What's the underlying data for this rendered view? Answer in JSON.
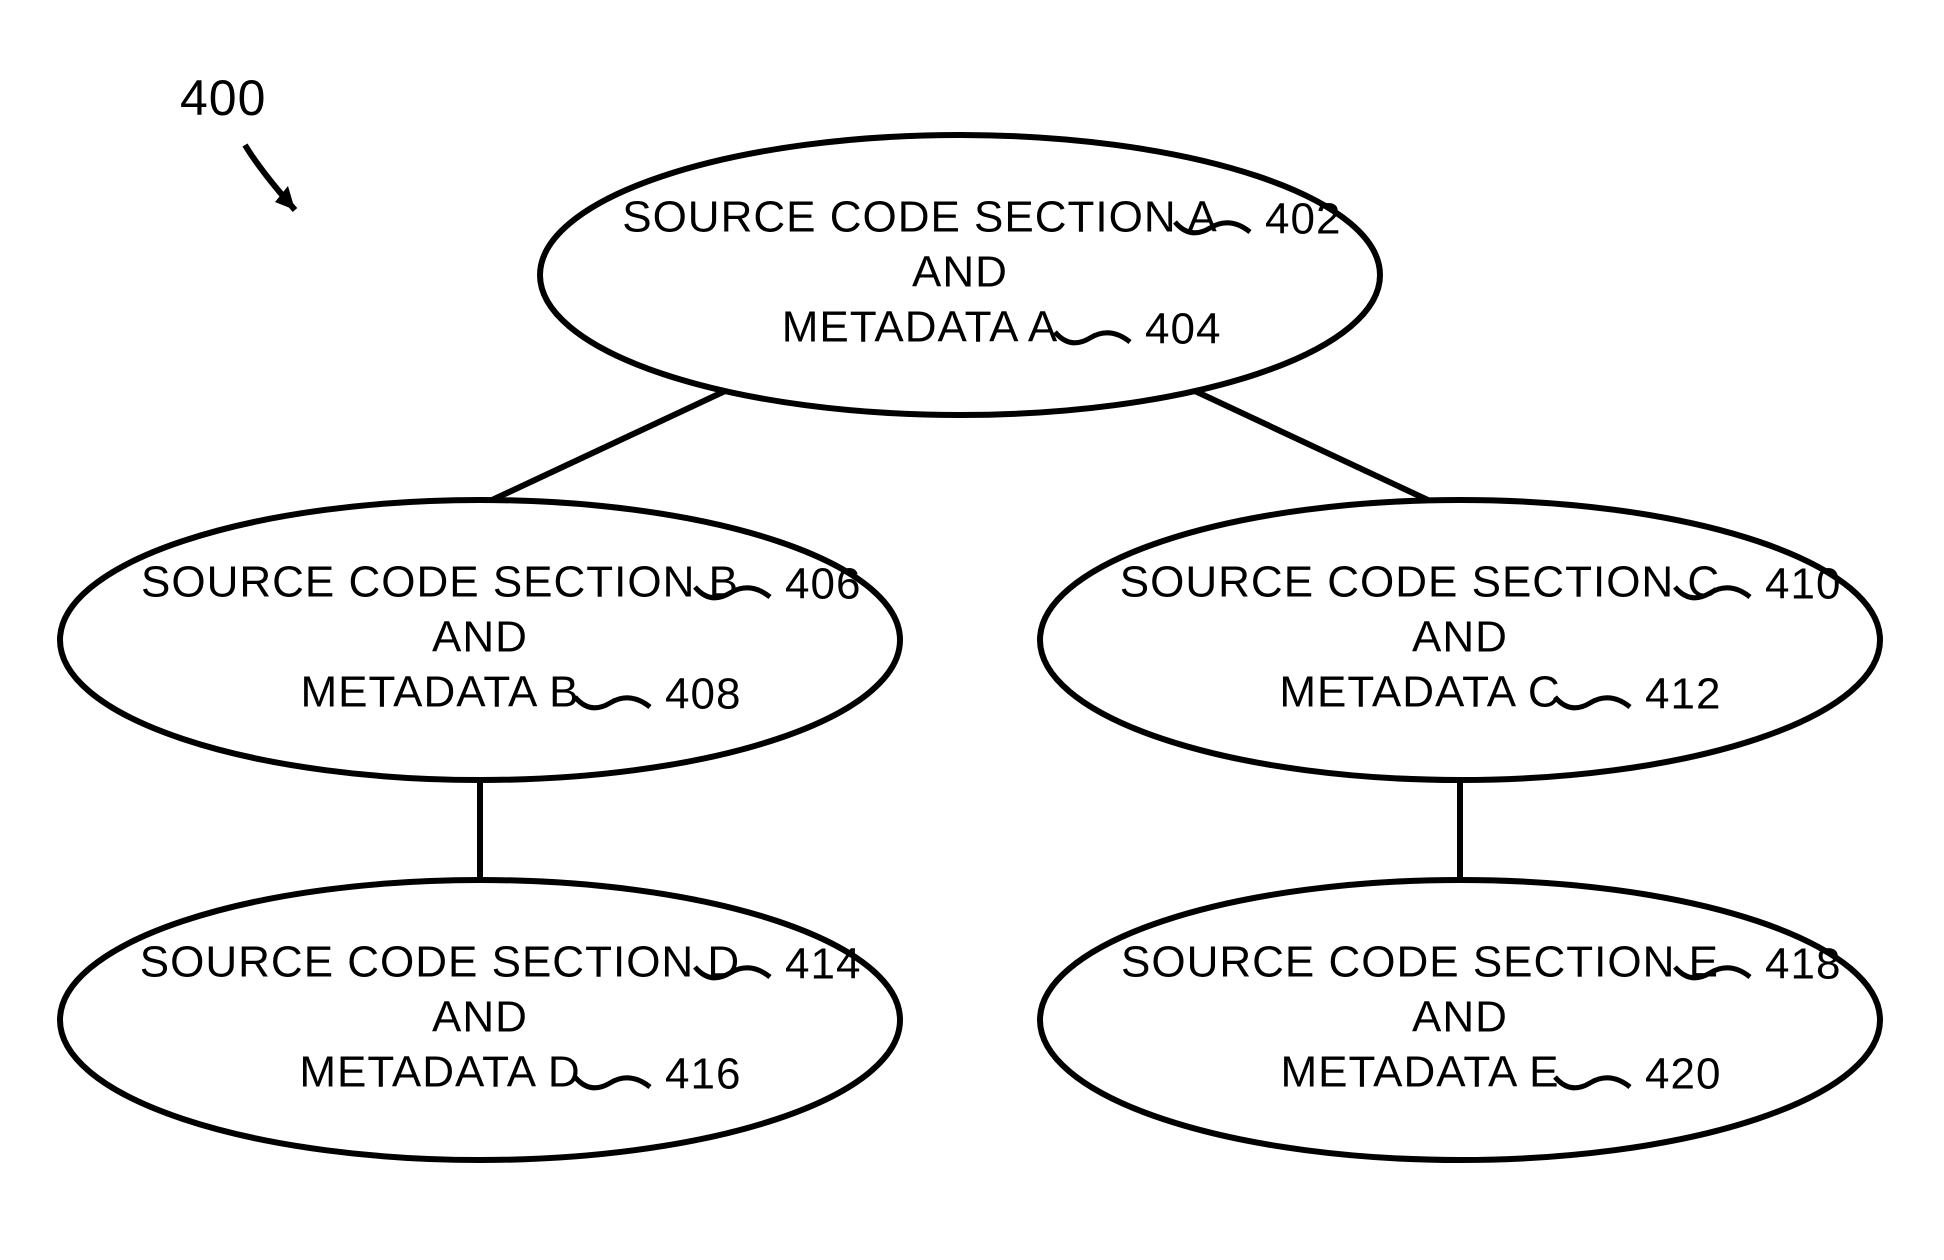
{
  "figure_label": "400",
  "nodes": {
    "A": {
      "line1": "SOURCE CODE SECTION A",
      "and": "AND",
      "line3": "METADATA A",
      "ref1": "402",
      "ref2": "404"
    },
    "B": {
      "line1": "SOURCE CODE SECTION B",
      "and": "AND",
      "line3": "METADATA B",
      "ref1": "406",
      "ref2": "408"
    },
    "C": {
      "line1": "SOURCE CODE SECTION C",
      "and": "AND",
      "line3": "METADATA C",
      "ref1": "410",
      "ref2": "412"
    },
    "D": {
      "line1": "SOURCE CODE SECTION D",
      "and": "AND",
      "line3": "METADATA D",
      "ref1": "414",
      "ref2": "416"
    },
    "E": {
      "line1": "SOURCE CODE SECTION E",
      "and": "AND",
      "line3": "METADATA E",
      "ref1": "418",
      "ref2": "420"
    }
  },
  "style": {
    "stroke": "#000000",
    "stroke_width": 6,
    "font_size_label": 44,
    "font_size_ref": 44,
    "font_size_fig": 50
  }
}
